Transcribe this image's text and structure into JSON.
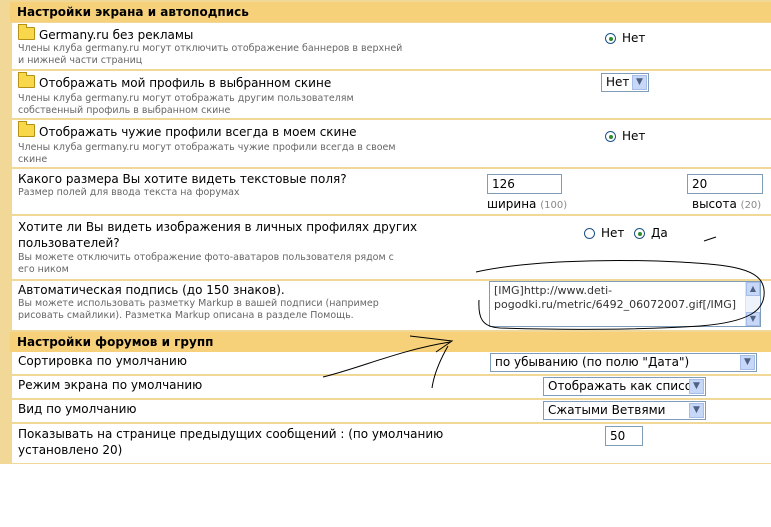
{
  "section1": {
    "title": "Настройки экрана и автоподпись"
  },
  "settings": [
    {
      "label": "Germany.ru без рекламы",
      "desc": [
        "Члены клуба germany.ru могут отключить отображение баннеров в верхней",
        "и нижней части страниц"
      ],
      "value": "Нет"
    },
    {
      "label": "Отображать мой профиль в выбранном скине",
      "desc": [
        "Члены клуба germany.ru могут отображать другим пользователям",
        "собственный профиль в выбранном скине"
      ],
      "value": "Нет"
    },
    {
      "label": "Отображать чужие профили всегда в моем скине",
      "desc": [
        "Члены клуба germany.ru могут отображать чужие профили всегда в своем",
        "скине"
      ],
      "value": "Нет"
    }
  ],
  "textfields": {
    "label": "Какого размера Вы хотите видеть текстовые поля?",
    "desc": "Размер полей для ввода текста на форумах",
    "width_value": "126",
    "width_label": "ширина",
    "width_hint": "(100)",
    "height_value": "20",
    "height_label": "высота",
    "height_hint": "(20)"
  },
  "images": {
    "label": [
      "Хотите ли Вы видеть изображения в личных профилях других",
      "пользователей?"
    ],
    "desc": [
      "Вы можете отключить отображение фото-аватаров пользователя рядом с",
      "его ником"
    ],
    "option_no": "Нет",
    "option_yes": "Да"
  },
  "signature": {
    "label": "Автоматическая подпись (до 150 знаков).",
    "desc": [
      "Вы можете использовать разметку Markup в вашей подписи (например",
      "рисовать смайлики). Разметка Markup описана в разделе Помощь."
    ],
    "value": [
      "[IMG]http://www.deti-",
      "pogodki.ru/metric/6492_06072007.gif[/IMG]"
    ]
  },
  "section2": {
    "title": "Настройки форумов и групп"
  },
  "forum": {
    "sort_label": "Сортировка по умолчанию",
    "sort_value": "по убыванию (по полю \"Дата\")",
    "mode_label": "Режим экрана по умолчанию",
    "mode_value": "Отображать как список",
    "view_label": "Вид по умолчанию",
    "view_value": "Сжатыми Ветвями",
    "prev_label": [
      "Показывать на странице предыдущих сообщений : (по умолчанию",
      "установлено 20)"
    ],
    "prev_value": "50"
  },
  "colors": {
    "header_bg": "#f7d07a",
    "border": "#f2d896",
    "annotation": "#000000"
  }
}
